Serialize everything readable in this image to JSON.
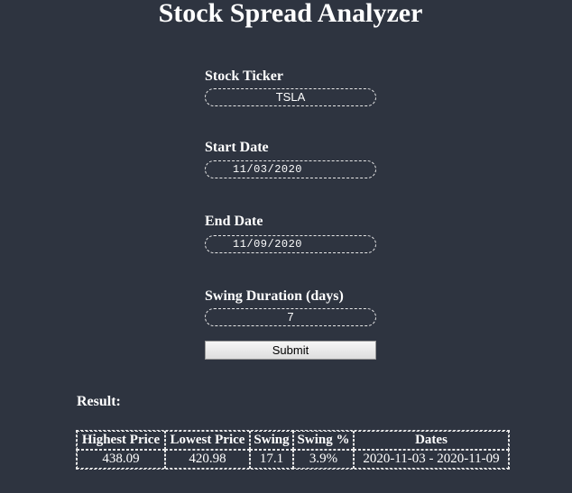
{
  "header": {
    "title": "Stock Spread Analyzer"
  },
  "form": {
    "ticker": {
      "label": "Stock Ticker",
      "value": "TSLA"
    },
    "start_date": {
      "label": "Start Date",
      "value": "11/03/2020"
    },
    "end_date": {
      "label": "End Date",
      "value": "11/09/2020"
    },
    "swing_duration": {
      "label": "Swing Duration (days)",
      "value": "7"
    },
    "submit_label": "Submit"
  },
  "result": {
    "label": "Result:",
    "columns": [
      "Highest Price",
      "Lowest Price",
      "Swing",
      "Swing %",
      "Dates"
    ],
    "rows": [
      [
        "438.09",
        "420.98",
        "17.1",
        "3.9%",
        "2020-11-03 - 2020-11-09"
      ]
    ]
  }
}
